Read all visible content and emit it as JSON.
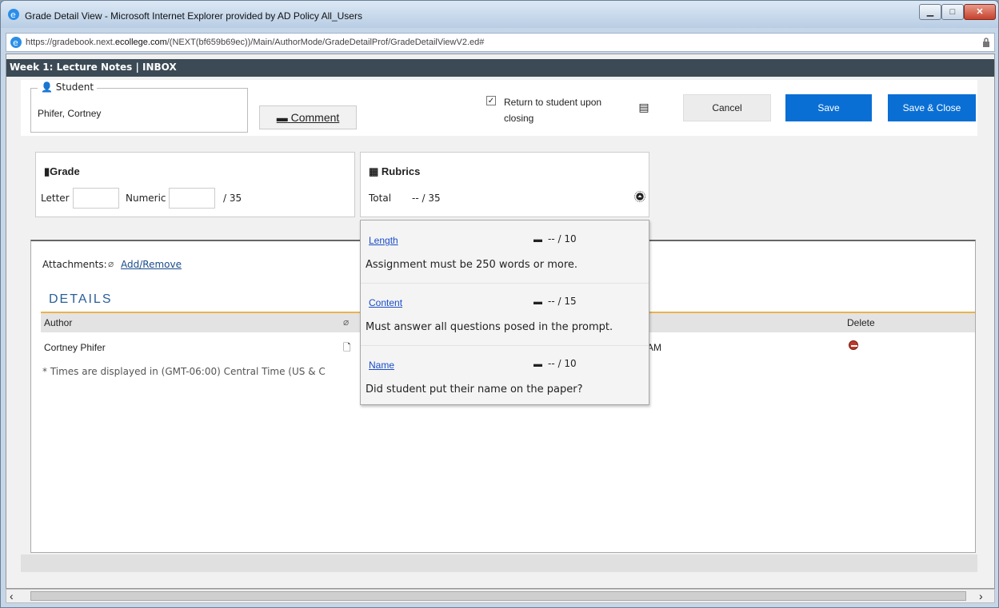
{
  "window": {
    "title": "Grade Detail View - Microsoft Internet Explorer provided by AD Policy All_Users",
    "url_prefix": "https://gradebook.next.",
    "url_domain": "ecollege.com",
    "url_rest": "/(NEXT(bf659b69ec))/Main/AuthorMode/GradeDetailProf/GradeDetailViewV2.ed#"
  },
  "header": {
    "title": "Week 1: Lecture Notes | INBOX"
  },
  "student": {
    "legend": "Student",
    "name": "Phifer, Cortney",
    "comment_label": "Comment",
    "return_label": "Return to student upon closing",
    "return_checked": true
  },
  "toolbar": {
    "cancel_label": "Cancel",
    "save_label": "Save",
    "save_close_label": "Save & Close"
  },
  "grade": {
    "title": "Grade",
    "letter_label": "Letter",
    "numeric_label": "Numeric",
    "max": "/ 35"
  },
  "rubrics": {
    "title": "Rubrics",
    "total_label": "Total",
    "total_value": "-- / 35",
    "items": [
      {
        "name": "Length",
        "score": "-- / 10",
        "description": "Assignment must be 250 words or more."
      },
      {
        "name": "Content",
        "score": "-- / 15",
        "description": "Must answer all questions posed in the prompt."
      },
      {
        "name": "Name",
        "score": "-- / 10",
        "description": "Did student put their name on the paper?"
      }
    ]
  },
  "attachments": {
    "label": "Attachments:",
    "link": "Add/Remove"
  },
  "details": {
    "heading": "DETAILS",
    "col_author": "Author",
    "col_delete": "Delete",
    "row_author": "Cortney Phifer",
    "row_time_fragment": "AM",
    "tz_note": "* Times are displayed in (GMT-06:00) Central Time (US & C"
  },
  "colors": {
    "primary_button": "#0a6fd4",
    "header_bar": "#3b4a55",
    "accent_rule": "#e9b34b"
  }
}
